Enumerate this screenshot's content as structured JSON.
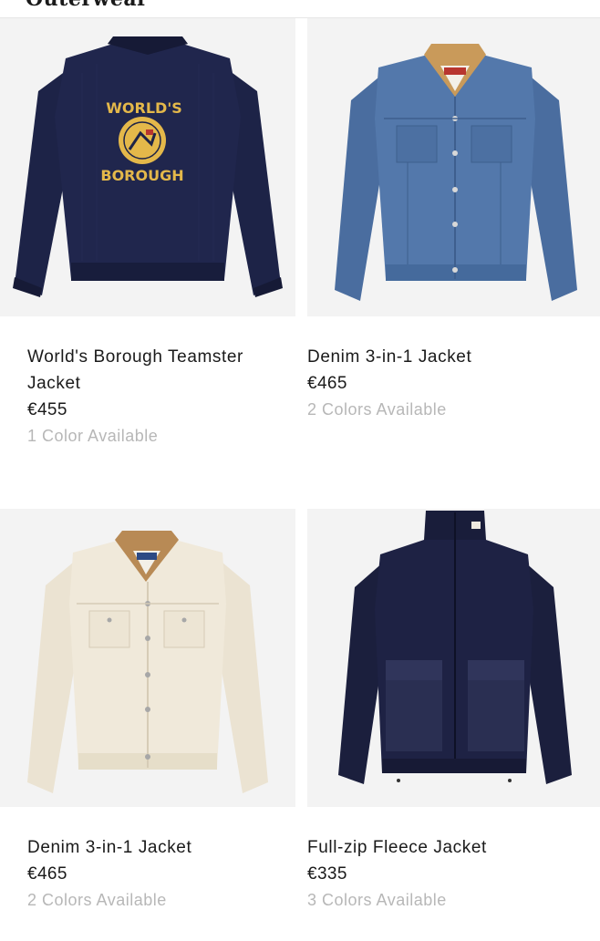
{
  "header": {
    "partial_title": "Outerwear"
  },
  "products": [
    {
      "name": "World's Borough Teamster Jacket",
      "name_line1": "World's Borough Teamster",
      "name_line2": "Jacket",
      "price": "€455",
      "colors_available": "1 Color Available",
      "patch_text_top": "WORLD'S",
      "patch_text_bottom": "BOROUGH",
      "colors": {
        "body": "#1d2347",
        "patch": "#e4b84a"
      }
    },
    {
      "name": "Denim 3-in-1 Jacket",
      "price": "€465",
      "colors_available": "2 Colors Available",
      "colors": {
        "body": "#4f73a6",
        "collar": "#c99a5a"
      }
    },
    {
      "name": "Denim 3-in-1 Jacket",
      "price": "€465",
      "colors_available": "2 Colors Available",
      "colors": {
        "body": "#efe8d9",
        "collar": "#b88a55"
      }
    },
    {
      "name": "Full-zip Fleece Jacket",
      "price": "€335",
      "colors_available": "3 Colors Available",
      "colors": {
        "body": "#1b1f3d",
        "pocket": "#2a2f52"
      }
    }
  ]
}
